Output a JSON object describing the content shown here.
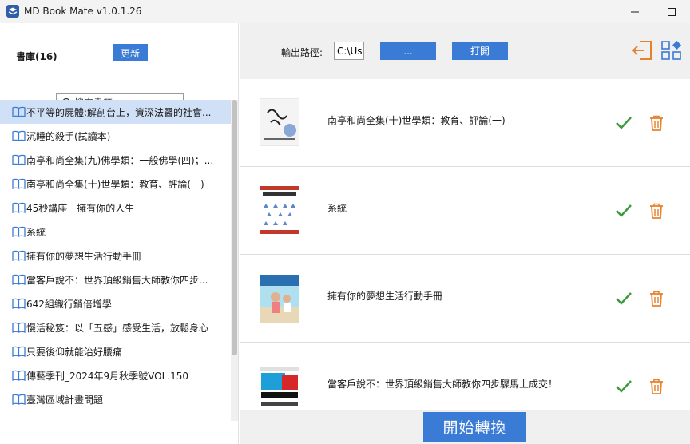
{
  "window": {
    "title": "MD Book Mate v1.0.1.26"
  },
  "library": {
    "label": "書庫(16)",
    "update_label": "更新",
    "search_placeholder": "搜索書籍",
    "items": [
      {
        "label": "不平等的屍體:解剖台上，資深法醫的社會..."
      },
      {
        "label": "沉睡的殺手(試讀本)"
      },
      {
        "label": "南亭和尚全集(九)佛學類：一般佛學(四)；..."
      },
      {
        "label": "南亭和尚全集(十)世學類：教育、評論(一)"
      },
      {
        "label": "45秒講座　擁有你的人生"
      },
      {
        "label": "系統"
      },
      {
        "label": "擁有你的夢想生活行動手冊"
      },
      {
        "label": "當客戶說不：世界頂級銷售大師教你四步..."
      },
      {
        "label": "642組織行銷倍增學"
      },
      {
        "label": "慢活秘笈：以「五感」感受生活，放鬆身心"
      },
      {
        "label": "只要後仰就能治好腰痛"
      },
      {
        "label": "傳藝季刊_2024年9月秋季號VOL.150"
      },
      {
        "label": "臺灣區域計畫問題"
      }
    ]
  },
  "toolbar": {
    "path_label": "輸出路徑:",
    "path_value": "C:\\Use",
    "browse_label": "...",
    "open_label": "打開"
  },
  "conversions": [
    {
      "title": "南亭和尚全集(十)世學類：教育、評論(一)"
    },
    {
      "title": "系統"
    },
    {
      "title": "擁有你的夢想生活行動手冊"
    },
    {
      "title": "當客戶說不：世界頂級銷售大師教你四步驟馬上成交！"
    }
  ],
  "start_label": "開始轉換",
  "colors": {
    "accent": "#3a7bd5",
    "check": "#3a9b3a",
    "trash": "#e8822a",
    "selected": "#cfe0f7"
  }
}
